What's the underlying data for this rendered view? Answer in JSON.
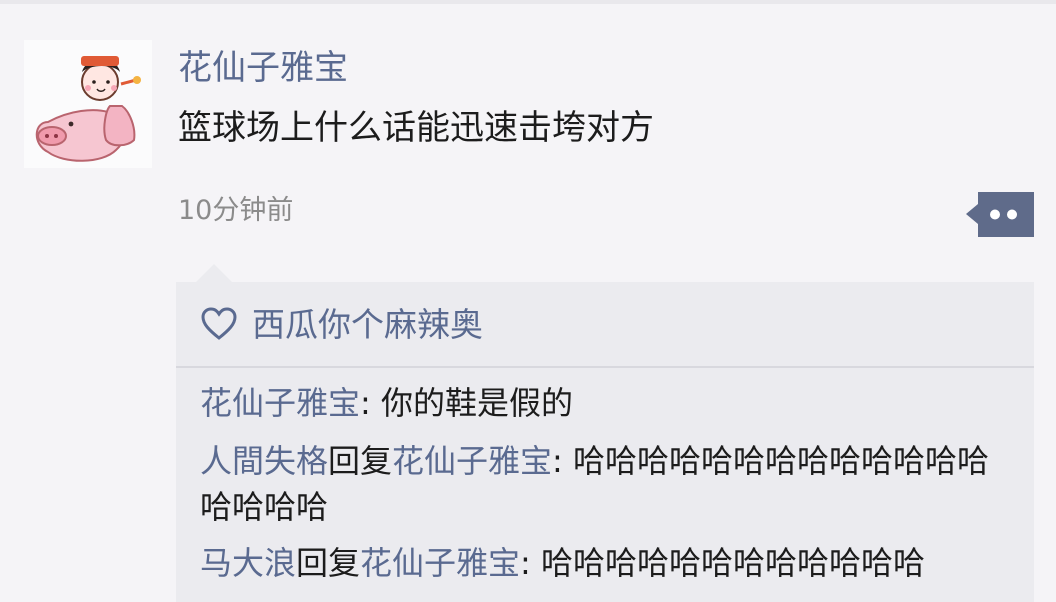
{
  "post": {
    "author": "花仙子雅宝",
    "text": "篮球场上什么话能迅速击垮对方",
    "time": "10分钟前",
    "avatar_icon": "pig-rider-cartoon-avatar",
    "more_icon": "more-dots-icon"
  },
  "likes": {
    "icon": "heart-outline-icon",
    "names": "西瓜你个麻辣奥"
  },
  "replies": [
    {
      "author": "花仙子雅宝",
      "separator": ": ",
      "text": "你的鞋是假的"
    },
    {
      "author": "人間失格",
      "reply_word": "回复",
      "reply_to": "花仙子雅宝",
      "separator": ": ",
      "text": "哈哈哈哈哈哈哈哈哈哈哈哈哈哈哈哈哈"
    },
    {
      "author": "马大浪",
      "reply_word": "回复",
      "reply_to": "花仙子雅宝",
      "separator": ": ",
      "text": "哈哈哈哈哈哈哈哈哈哈哈哈"
    }
  ],
  "colors": {
    "background": "#f5f4f7",
    "name_blue": "#5a6a90",
    "text": "#1c1c1c",
    "muted": "#8b8b8b",
    "comment_bg": "#ebebef",
    "more_button": "#5f6b8a"
  }
}
